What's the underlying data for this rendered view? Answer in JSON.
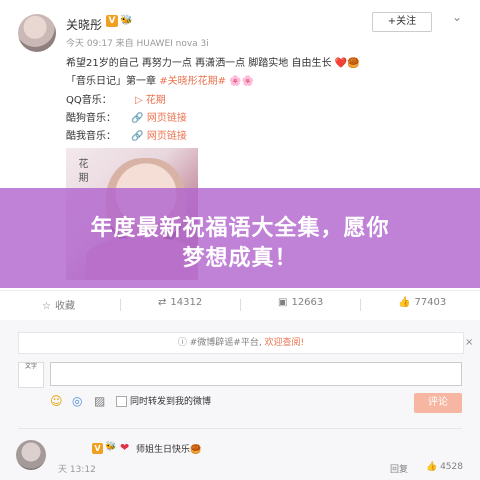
{
  "post": {
    "user_name": "关晓彤",
    "verified": "V",
    "fan_badge": "铁粉",
    "meta": "今天 09:17 来自 HUAWEI nova 3i",
    "follow_label": "+关注",
    "lines": {
      "l1": "希望21岁的自己 再努力一点 再潇洒一点 脚踏实地 自由生长 ❤️🥮",
      "l2_prefix": "「音乐日记」第一章 ",
      "l2_tag": "#关晓彤花期#",
      "l2_suffix": " 🌸🌸",
      "qq_label": "QQ音乐：",
      "qq_link": "▷ 花期",
      "kugou_label": "酷狗音乐：",
      "kugou_link": "🔗 网页链接",
      "kuwo_label": "酷我音乐：",
      "kuwo_link": "🔗 网页链接"
    },
    "photo_text": "花期"
  },
  "banner": {
    "line1": "年度最新祝福语大全集，愿你",
    "line2": "梦想成真！"
  },
  "actions": {
    "favorite": "收藏",
    "repost": "14312",
    "comment": "12663",
    "like": "77403"
  },
  "notice": {
    "prefix": "#微博辟谣#平台, ",
    "link": "欢迎查阅!",
    "close": "×"
  },
  "compose": {
    "my_avatar_text": "文字",
    "checkbox_label": "同时转发到我的微博",
    "submit_label": "评论"
  },
  "comment": {
    "text": "师姐生日快乐🥮",
    "time": "天 13:12",
    "reply": "回复",
    "likes": "4528"
  },
  "colors": {
    "accent": "#eb7350",
    "banner": "#b266ce",
    "submit": "#f7b6a2"
  }
}
